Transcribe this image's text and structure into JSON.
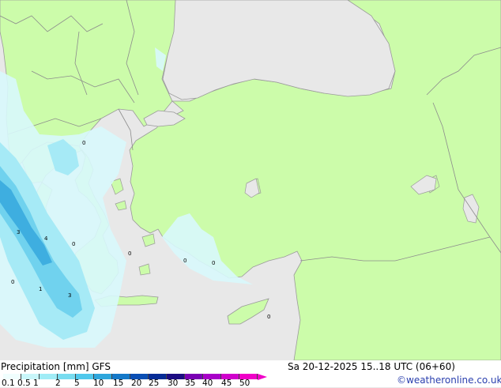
{
  "map": {
    "colors": {
      "sea": "#e8e8e8",
      "land": "#ccfcaa",
      "border": "#8c8c8c",
      "coast": "#9a9a9a"
    },
    "precip_labels": [
      "0",
      "3",
      "4",
      "0",
      "0",
      "0",
      "0",
      "0",
      "1",
      "3",
      "0"
    ]
  },
  "footer": {
    "title": "Precipitation [mm]  GFS",
    "datetime": "Sa 20-12-2025 15..18 UTC (06+60)",
    "credit": "©weatheronline.co.uk",
    "scale_ticks": [
      "0.1",
      "0.5",
      "1",
      "2",
      "5",
      "10",
      "15",
      "20",
      "25",
      "30",
      "35",
      "40",
      "45",
      "50"
    ],
    "scale_colors": [
      "#f0fefe",
      "#c8f6fa",
      "#a0ecf6",
      "#78dcf0",
      "#50c8ec",
      "#2ea6dc",
      "#1478c8",
      "#0a4eb4",
      "#062c96",
      "#1c0c82",
      "#7a00b4",
      "#a800c8",
      "#d000cc",
      "#f000c8"
    ]
  }
}
